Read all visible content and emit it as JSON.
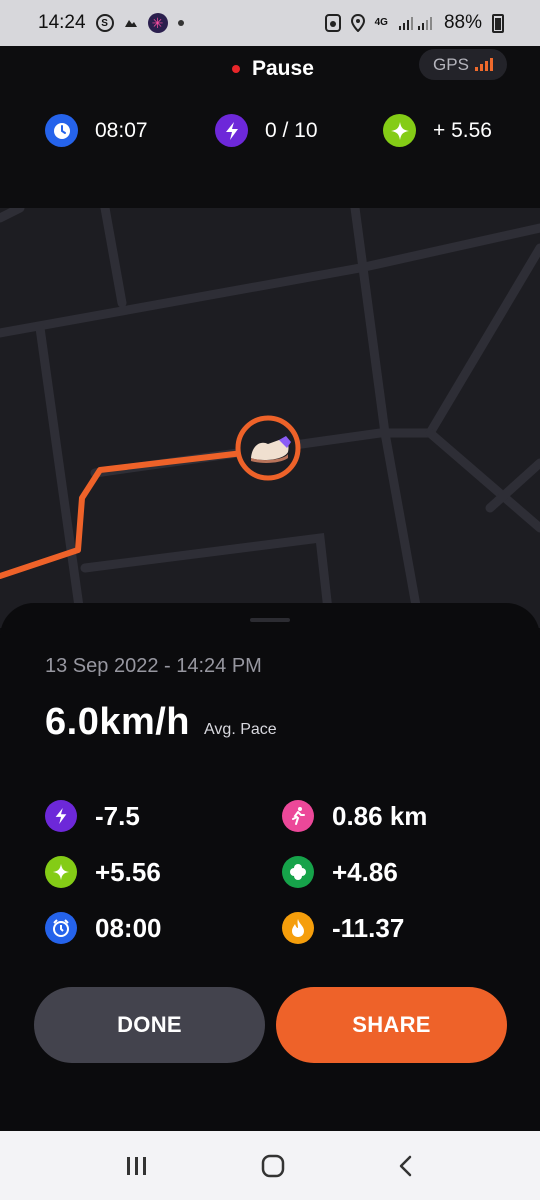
{
  "status_bar": {
    "time": "14:24",
    "network_label": "4G",
    "battery": "88%"
  },
  "header": {
    "pause_label": "Pause",
    "gps_label": "GPS"
  },
  "top_stats": [
    {
      "icon": "clock-icon",
      "value": "08:07",
      "color": "#2563eb"
    },
    {
      "icon": "energy-icon",
      "value": "0 / 10",
      "color": "#6d28d9"
    },
    {
      "icon": "sparkle-icon",
      "value": "+ 5.56",
      "color": "#84cc16"
    }
  ],
  "map": {
    "route_color": "#ee6229",
    "marker_icon": "sneaker-icon"
  },
  "summary": {
    "date": "13 Sep 2022 - 14:24 PM",
    "pace_value": "6.0km/h",
    "pace_label": "Avg. Pace",
    "metrics_left": [
      {
        "icon": "energy-icon",
        "value": "-7.5",
        "color": "#6d28d9"
      },
      {
        "icon": "sparkle-icon",
        "value": "+5.56",
        "color": "#84cc16"
      },
      {
        "icon": "alarm-icon",
        "value": "08:00",
        "color": "#2563eb"
      }
    ],
    "metrics_right": [
      {
        "icon": "runner-icon",
        "value": "0.86 km",
        "color": "#ec4899"
      },
      {
        "icon": "clover-icon",
        "value": "+4.86",
        "color": "#16a34a"
      },
      {
        "icon": "flame-icon",
        "value": "-11.37",
        "color": "#f59e0b"
      }
    ]
  },
  "buttons": {
    "done_label": "DONE",
    "share_label": "SHARE"
  },
  "navbar": {
    "recent_icon": "recent-apps-icon",
    "home_icon": "home-icon",
    "back_icon": "back-icon"
  }
}
